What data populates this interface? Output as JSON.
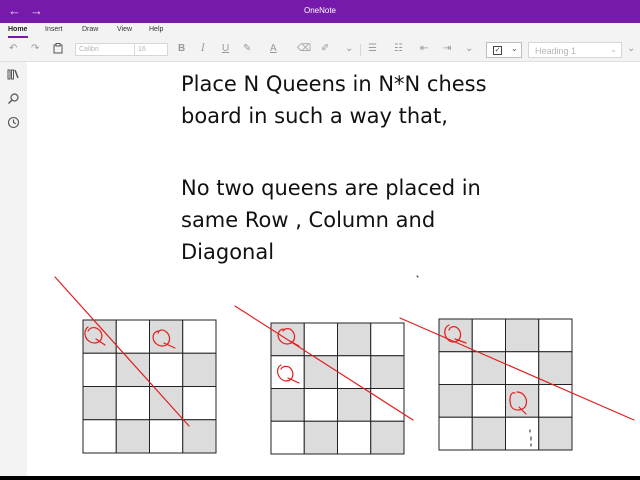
{
  "window": {
    "title": "OneNote",
    "back_icon": "←",
    "forward_icon": "→"
  },
  "tabs": [
    {
      "label": "Home",
      "active": true
    },
    {
      "label": "Insert"
    },
    {
      "label": "Draw"
    },
    {
      "label": "View"
    },
    {
      "label": "Help"
    }
  ],
  "toolbar": {
    "font_name": "Calibri",
    "font_size": "16",
    "style_value": "Heading 1",
    "icons": [
      "undo-icon",
      "redo-icon",
      "clipboard-icon",
      "bold-icon",
      "italic-icon",
      "underline-icon",
      "highlight-icon",
      "font-color-icon",
      "clear-formatting-icon",
      "more-chevron-icon",
      "bullets-icon",
      "numbering-icon",
      "outdent-icon",
      "indent-icon",
      "to-do-checkbox-icon",
      "chevron-down-icon"
    ]
  },
  "note": {
    "lines_block1": [
      "Place N Queens in N*N chess",
      "board in such a way that,"
    ],
    "lines_block2": [
      "No two queens are placed in",
      "same Row , Column and",
      "Diagonal"
    ]
  },
  "boards": [
    {
      "size": 4,
      "queens": [
        [
          0,
          0
        ],
        [
          0,
          2
        ]
      ]
    },
    {
      "size": 4,
      "queens": [
        [
          0,
          0
        ],
        [
          1,
          0
        ]
      ]
    },
    {
      "size": 4,
      "queens": [
        [
          0,
          0
        ],
        [
          2,
          2
        ]
      ]
    }
  ],
  "handwriting": {
    "queen_mark": "Q"
  },
  "colors": {
    "accent": "#7719aa",
    "ink": "#e02020",
    "shade": "#dcdcdc"
  }
}
